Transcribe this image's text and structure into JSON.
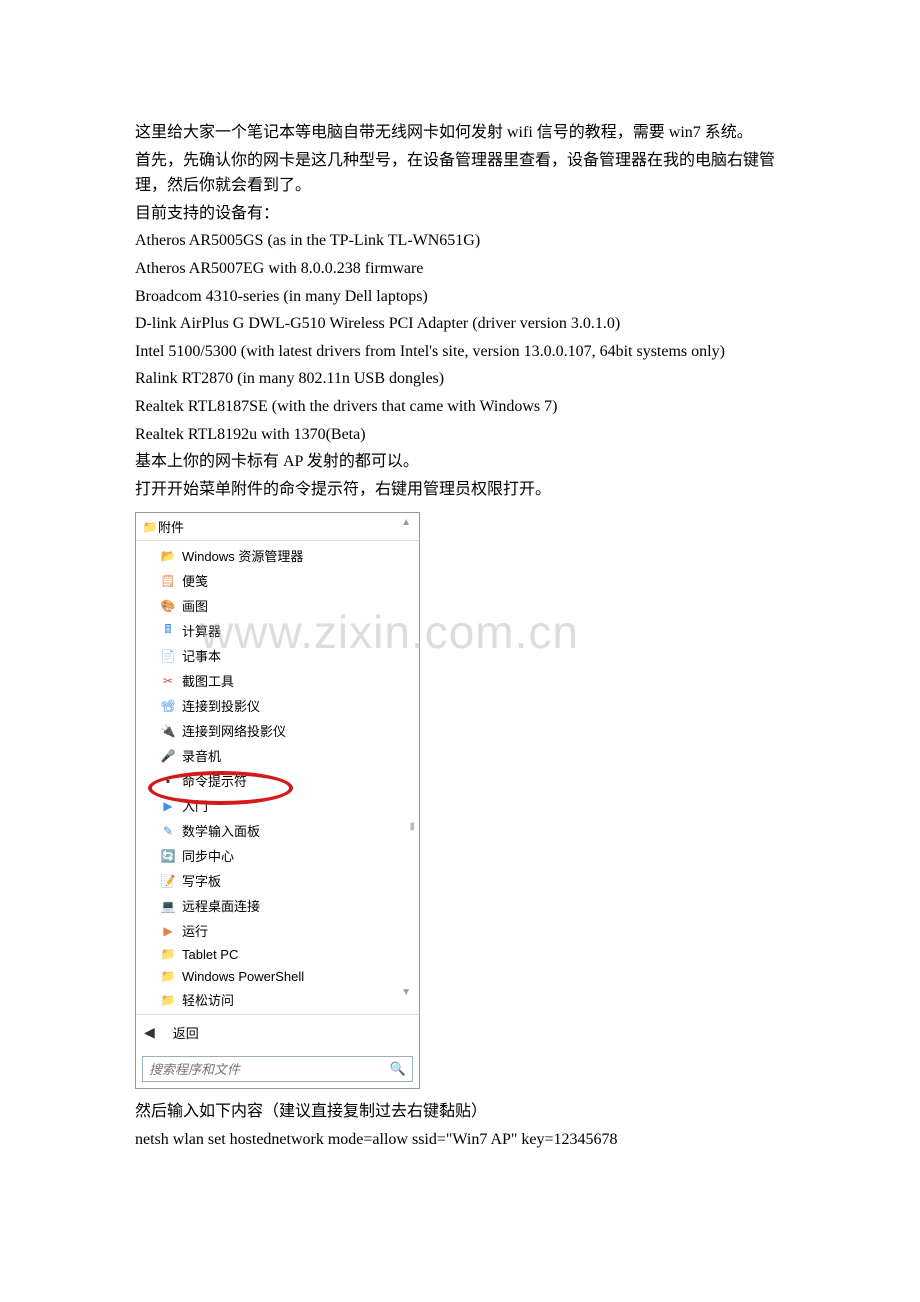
{
  "doc": {
    "p1": "这里给大家一个笔记本等电脑自带无线网卡如何发射 wifi 信号的教程，需要 win7 系统。",
    "p2": "首先，先确认你的网卡是这几种型号，在设备管理器里查看，设备管理器在我的电脑右键管理，然后你就会看到了。",
    "p3": "目前支持的设备有：",
    "d1": "Atheros AR5005GS (as in the TP-Link TL-WN651G)",
    "d2": "Atheros AR5007EG with 8.0.0.238 firmware",
    "d3": "Broadcom 4310-series (in many Dell laptops)",
    "d4": "D-link AirPlus G DWL-G510 Wireless PCI Adapter (driver version 3.0.1.0)",
    "d5": "Intel 5100/5300 (with latest drivers from Intel's site, version 13.0.0.107, 64bit systems only)",
    "d6": "Ralink RT2870 (in many 802.11n USB dongles)",
    "d7": "Realtek RTL8187SE (with the drivers that came with Windows 7)",
    "d8": "Realtek RTL8192u with 1370(Beta)",
    "p4": "基本上你的网卡标有 AP 发射的都可以。",
    "p5": "打开开始菜单附件的命令提示符，右键用管理员权限打开。",
    "p6": "然后输入如下内容（建议直接复制过去右键黏贴）",
    "p7": "netsh wlan set hostednetwork mode=allow ssid=\"Win7 AP\" key=12345678"
  },
  "watermark": "www.zixin.com.cn",
  "startmenu": {
    "folder_label": "附件",
    "items": [
      {
        "label": "Windows 资源管理器"
      },
      {
        "label": "便笺"
      },
      {
        "label": "画图"
      },
      {
        "label": "计算器"
      },
      {
        "label": "记事本"
      },
      {
        "label": "截图工具"
      },
      {
        "label": "连接到投影仪"
      },
      {
        "label": "连接到网络投影仪"
      },
      {
        "label": "录音机"
      },
      {
        "label": "命令提示符"
      },
      {
        "label": "入门"
      },
      {
        "label": "数学输入面板"
      },
      {
        "label": "同步中心"
      },
      {
        "label": "写字板"
      },
      {
        "label": "远程桌面连接"
      },
      {
        "label": "运行"
      },
      {
        "label": "Tablet PC"
      },
      {
        "label": "Windows PowerShell"
      },
      {
        "label": "轻松访问"
      }
    ],
    "back_label": "返回",
    "search_placeholder": "搜索程序和文件"
  }
}
